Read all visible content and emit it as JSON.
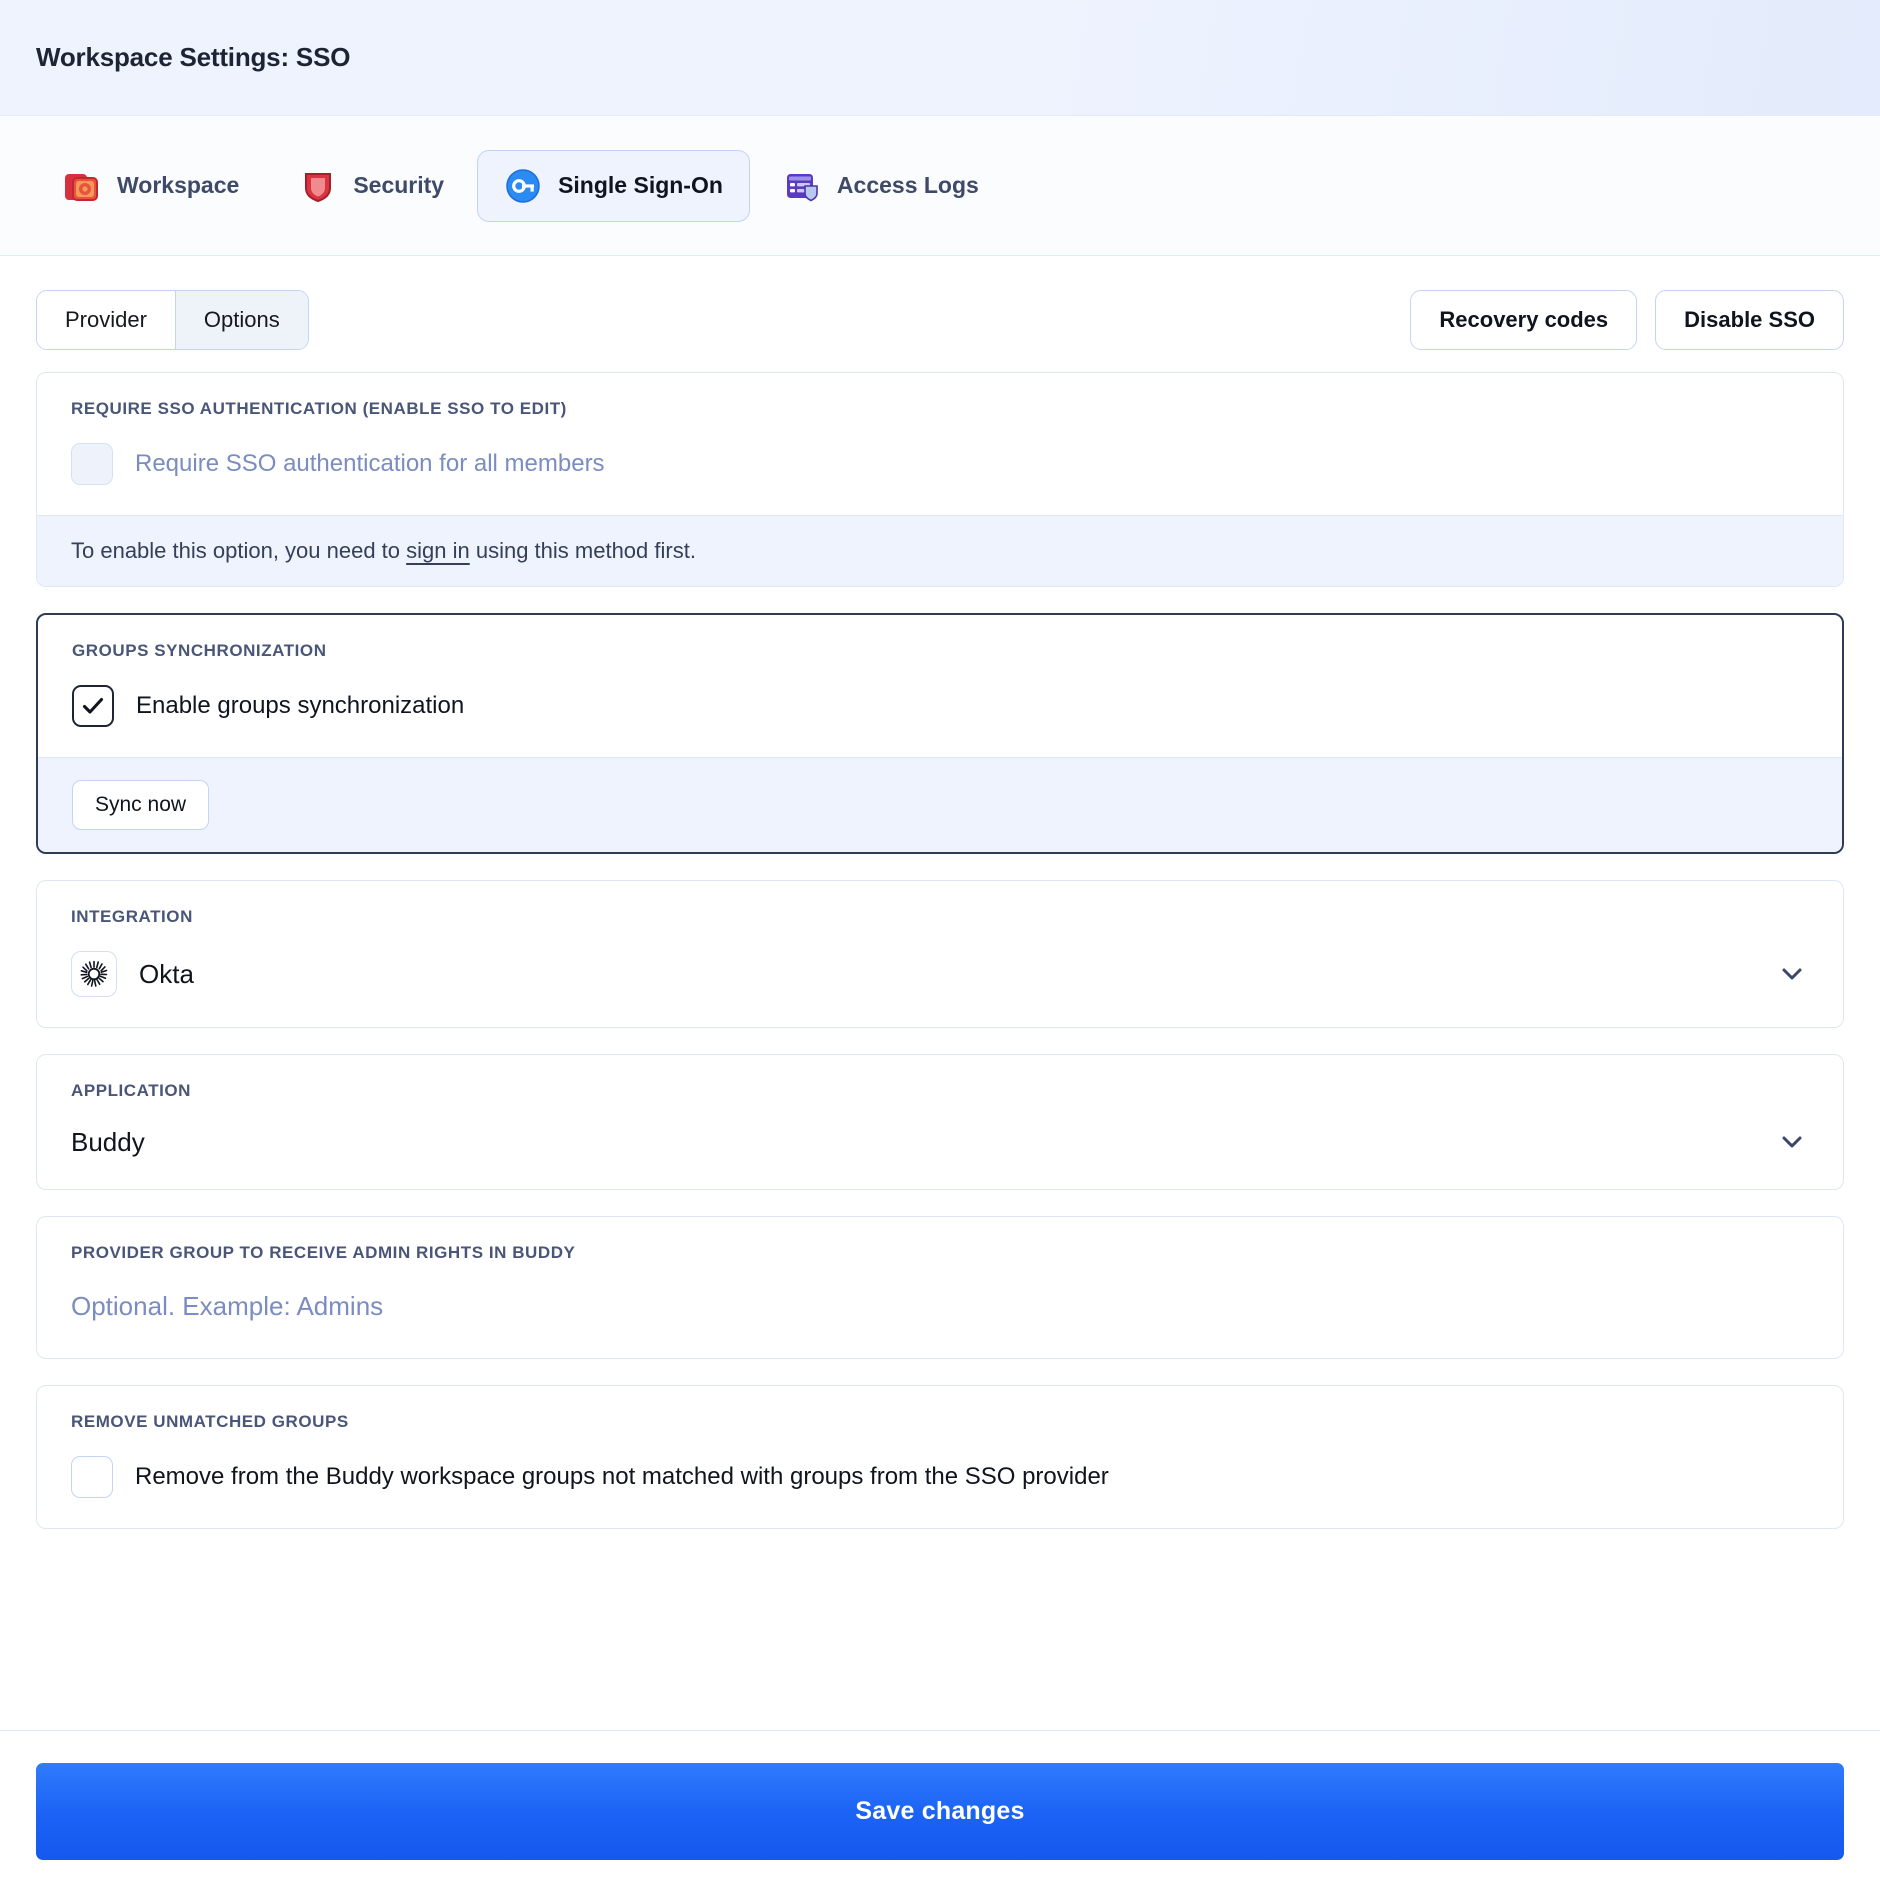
{
  "header": {
    "title": "Workspace Settings: SSO"
  },
  "tabs": [
    {
      "label": "Workspace",
      "icon": "workspace-gear-icon",
      "active": false
    },
    {
      "label": "Security",
      "icon": "shield-icon",
      "active": false
    },
    {
      "label": "Single Sign-On",
      "icon": "key-circle-icon",
      "active": true
    },
    {
      "label": "Access Logs",
      "icon": "logs-shield-icon",
      "active": false
    }
  ],
  "toolbar": {
    "segments": [
      {
        "label": "Provider",
        "active": false
      },
      {
        "label": "Options",
        "active": true
      }
    ],
    "recovery_codes_label": "Recovery codes",
    "disable_sso_label": "Disable SSO"
  },
  "require_sso": {
    "section_label": "REQUIRE SSO AUTHENTICATION (ENABLE SSO TO EDIT)",
    "checkbox_label": "Require SSO authentication for all members",
    "checked": false,
    "disabled": true,
    "note_prefix": "To enable this option, you need to ",
    "note_link": "sign in",
    "note_suffix": " using this method first."
  },
  "groups_sync": {
    "section_label": "GROUPS SYNCHRONIZATION",
    "checkbox_label": "Enable groups synchronization",
    "checked": true,
    "sync_button_label": "Sync now"
  },
  "integration": {
    "section_label": "INTEGRATION",
    "value": "Okta",
    "logo": "okta-logo-icon",
    "chevron": "chevron-down-icon"
  },
  "application": {
    "section_label": "APPLICATION",
    "value": "Buddy",
    "chevron": "chevron-down-icon"
  },
  "admin_group": {
    "section_label": "PROVIDER GROUP TO RECEIVE ADMIN RIGHTS IN BUDDY",
    "value": "",
    "placeholder": "Optional. Example: Admins"
  },
  "remove_unmatched": {
    "section_label": "REMOVE UNMATCHED GROUPS",
    "checkbox_label": "Remove from the Buddy workspace groups not matched with groups from the SSO provider",
    "checked": false
  },
  "footer": {
    "save_label": "Save changes"
  },
  "colors": {
    "accent_blue": "#1c63f5",
    "sso_icon_blue": "#2b8bf2",
    "security_red": "#d93442",
    "workspace_red": "#e8533f",
    "logs_purple": "#5b3bc4",
    "label_gray": "#4a5678",
    "muted_blue": "#7b8cc0"
  }
}
